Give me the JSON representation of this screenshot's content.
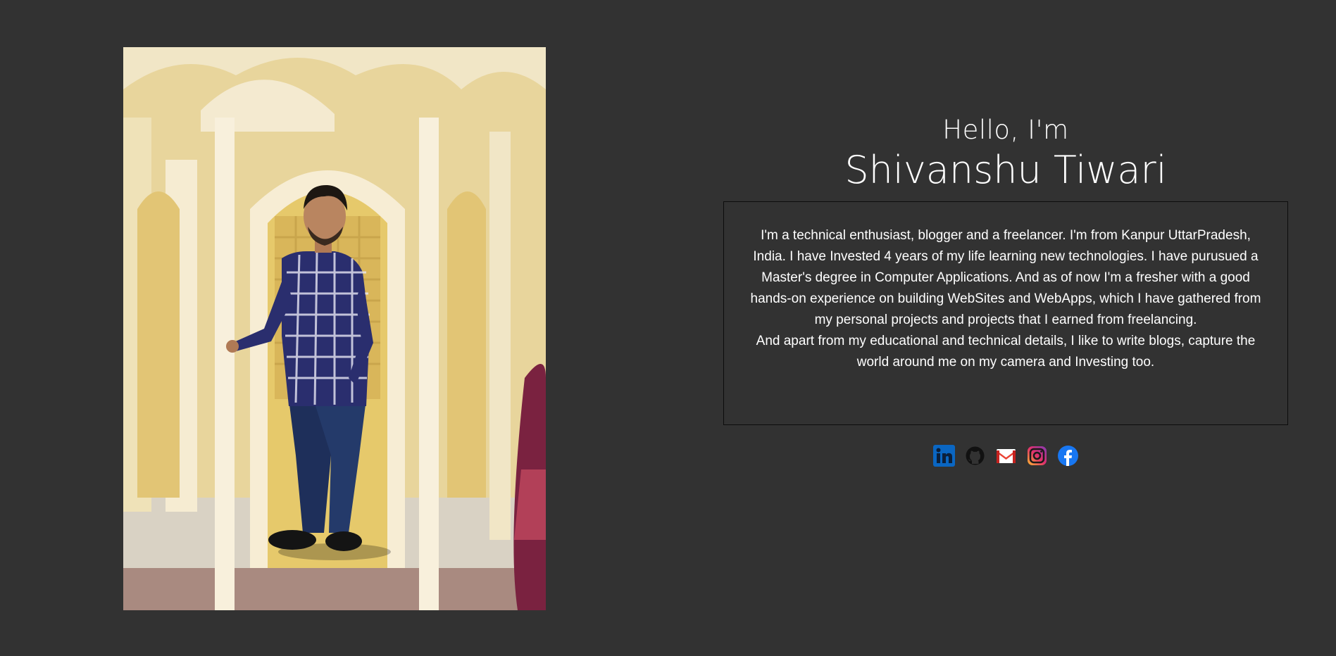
{
  "hero": {
    "greeting": "Hello, I'm",
    "name": "Shivanshu Tiwari",
    "bio_paragraph_1": "I'm a technical enthusiast, blogger and a freelancer. I'm from Kanpur UttarPradesh, India. I have Invested 4 years of my life learning new technologies. I have purusued a Master's degree in Computer Applications. And as of now I'm a fresher with a good hands-on experience on building WebSites and WebApps, which I have gathered from my personal projects and projects that I earned from freelancing.",
    "bio_paragraph_2": "And apart from my educational and technical details, I like to write blogs, capture the world around me on my camera and Investing too."
  },
  "photo": {
    "icon": "portrait-photo"
  },
  "socials": [
    {
      "icon": "linkedin-icon",
      "color": "#0a66c2"
    },
    {
      "icon": "github-icon",
      "color": "#111111"
    },
    {
      "icon": "gmail-icon",
      "color": "#ea4335"
    },
    {
      "icon": "instagram-icon",
      "color": "#e1306c"
    },
    {
      "icon": "facebook-icon",
      "color": "#1877f2"
    }
  ],
  "colors": {
    "background": "#323232",
    "text": "#ffffff",
    "bio_border": "#0c0c0c"
  }
}
